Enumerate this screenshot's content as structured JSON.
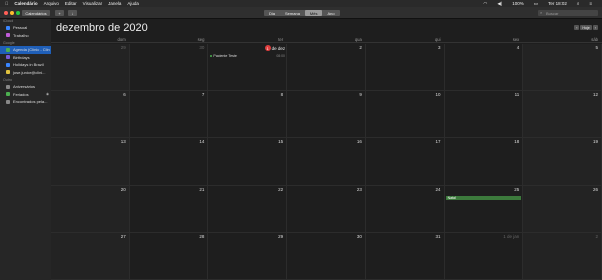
{
  "menubar": {
    "app": "Calendário",
    "items": [
      "Arquivo",
      "Editar",
      "Visualizar",
      "Janela",
      "Ajuda"
    ],
    "battery": "100%",
    "clock": "Ter 18:02"
  },
  "toolbar": {
    "calendars_label": "Calendários",
    "add_label": "+",
    "download_label": "↓",
    "views": [
      "Dia",
      "Semana",
      "Mês",
      "Ano"
    ],
    "active_view": "Mês",
    "search_placeholder": "Buscar"
  },
  "sidebar": {
    "icloud_header": "iCloud",
    "icloud": [
      {
        "label": "Pessoal",
        "color": "#3a86ff"
      },
      {
        "label": "Trabalho",
        "color": "#c05cd8"
      }
    ],
    "google_header": "Google",
    "google": [
      {
        "label": "Agenda (Clínic - Clin",
        "color": "#4caf50"
      },
      {
        "label": "Birthdays",
        "color": "#7b5cd8"
      },
      {
        "label": "Holidays in Brazil",
        "color": "#3a86ff"
      },
      {
        "label": "jose.junior@clini...",
        "color": "#e0c23e"
      }
    ],
    "other_header": "Outro",
    "other": [
      {
        "label": "Aniversários",
        "color": "#888888"
      },
      {
        "label": "Feriados",
        "color": "#4caf50"
      },
      {
        "label": "Encontrados pela...",
        "color": "#888888"
      }
    ]
  },
  "main": {
    "title": "dezembro de 2020",
    "today_label": "Hoje",
    "prev": "‹",
    "next": "›",
    "weekdays": [
      "dom",
      "seg",
      "ter",
      "qua",
      "qui",
      "sex",
      "sáb"
    ],
    "days": [
      "29",
      "30",
      "1 de dez",
      "2",
      "3",
      "4",
      "5",
      "6",
      "7",
      "8",
      "9",
      "10",
      "11",
      "12",
      "13",
      "14",
      "15",
      "16",
      "17",
      "18",
      "19",
      "20",
      "21",
      "22",
      "23",
      "24",
      "25",
      "26",
      "27",
      "28",
      "29",
      "30",
      "31",
      "1 de jan",
      "2"
    ],
    "today_circle": "1",
    "today_suffix": "de dez",
    "event_patient": "Paciente Teste",
    "event_patient_time": "08:00",
    "event_natal": "Natal"
  }
}
